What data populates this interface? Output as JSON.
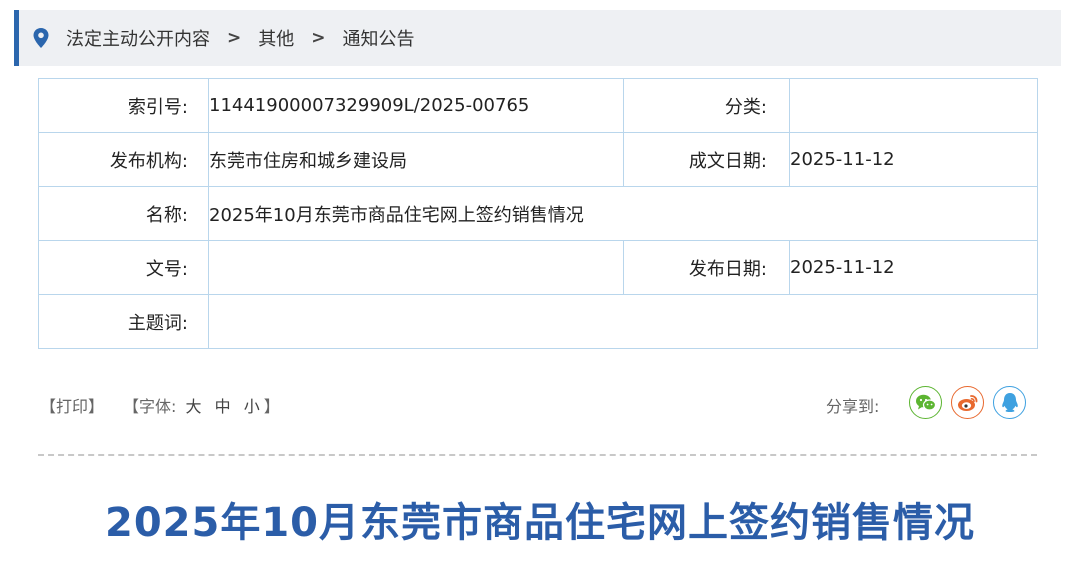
{
  "breadcrumb": {
    "items": [
      "法定主动公开内容",
      "其他",
      "通知公告"
    ],
    "separator": ">"
  },
  "meta": {
    "index_label": "索引号:",
    "index_value": "11441900007329909L/2025-00765",
    "category_label": "分类:",
    "category_value": "",
    "publisher_label": "发布机构:",
    "publisher_value": "东莞市住房和城乡建设局",
    "written_date_label": "成文日期:",
    "written_date_value": "2025-11-12",
    "name_label": "名称:",
    "name_value": "2025年10月东莞市商品住宅网上签约销售情况",
    "doc_number_label": "文号:",
    "doc_number_value": "",
    "publish_date_label": "发布日期:",
    "publish_date_value": "2025-11-12",
    "keywords_label": "主题词:",
    "keywords_value": ""
  },
  "toolbar": {
    "print_label": "【打印】",
    "font_prefix": "【字体:",
    "font_large": "大",
    "font_medium": "中",
    "font_small": "小",
    "font_suffix": "】",
    "share_label": "分享到:",
    "share_icons": [
      "wechat-icon",
      "weibo-icon",
      "qq-icon"
    ]
  },
  "colors": {
    "accent": "#2b66ad",
    "title": "#2b5da8",
    "table_border": "#b9d6ec",
    "wechat": "#5cb531",
    "weibo": "#e8692f",
    "qq": "#3fa1e0"
  },
  "article": {
    "title": "2025年10月东莞市商品住宅网上签约销售情况"
  }
}
